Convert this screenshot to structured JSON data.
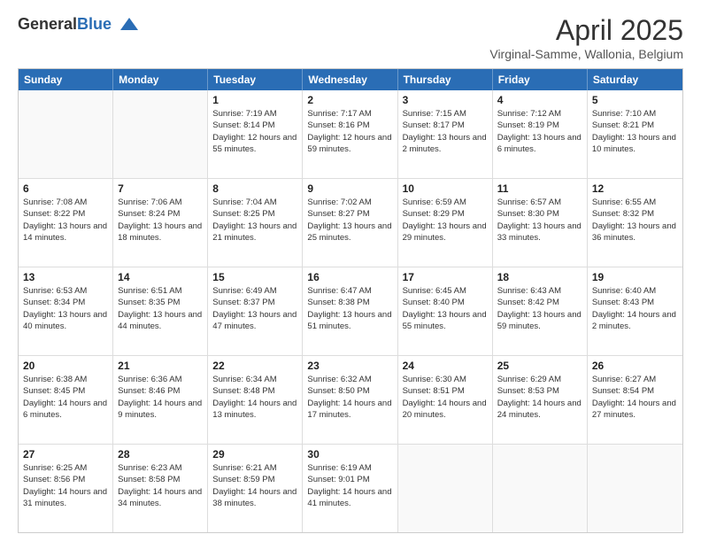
{
  "logo": {
    "general": "General",
    "blue": "Blue"
  },
  "title": "April 2025",
  "subtitle": "Virginal-Samme, Wallonia, Belgium",
  "calendar": {
    "headers": [
      "Sunday",
      "Monday",
      "Tuesday",
      "Wednesday",
      "Thursday",
      "Friday",
      "Saturday"
    ],
    "rows": [
      [
        {
          "day": "",
          "info": "",
          "empty": true
        },
        {
          "day": "",
          "info": "",
          "empty": true
        },
        {
          "day": "1",
          "info": "Sunrise: 7:19 AM\nSunset: 8:14 PM\nDaylight: 12 hours and 55 minutes.",
          "empty": false
        },
        {
          "day": "2",
          "info": "Sunrise: 7:17 AM\nSunset: 8:16 PM\nDaylight: 12 hours and 59 minutes.",
          "empty": false
        },
        {
          "day": "3",
          "info": "Sunrise: 7:15 AM\nSunset: 8:17 PM\nDaylight: 13 hours and 2 minutes.",
          "empty": false
        },
        {
          "day": "4",
          "info": "Sunrise: 7:12 AM\nSunset: 8:19 PM\nDaylight: 13 hours and 6 minutes.",
          "empty": false
        },
        {
          "day": "5",
          "info": "Sunrise: 7:10 AM\nSunset: 8:21 PM\nDaylight: 13 hours and 10 minutes.",
          "empty": false
        }
      ],
      [
        {
          "day": "6",
          "info": "Sunrise: 7:08 AM\nSunset: 8:22 PM\nDaylight: 13 hours and 14 minutes.",
          "empty": false
        },
        {
          "day": "7",
          "info": "Sunrise: 7:06 AM\nSunset: 8:24 PM\nDaylight: 13 hours and 18 minutes.",
          "empty": false
        },
        {
          "day": "8",
          "info": "Sunrise: 7:04 AM\nSunset: 8:25 PM\nDaylight: 13 hours and 21 minutes.",
          "empty": false
        },
        {
          "day": "9",
          "info": "Sunrise: 7:02 AM\nSunset: 8:27 PM\nDaylight: 13 hours and 25 minutes.",
          "empty": false
        },
        {
          "day": "10",
          "info": "Sunrise: 6:59 AM\nSunset: 8:29 PM\nDaylight: 13 hours and 29 minutes.",
          "empty": false
        },
        {
          "day": "11",
          "info": "Sunrise: 6:57 AM\nSunset: 8:30 PM\nDaylight: 13 hours and 33 minutes.",
          "empty": false
        },
        {
          "day": "12",
          "info": "Sunrise: 6:55 AM\nSunset: 8:32 PM\nDaylight: 13 hours and 36 minutes.",
          "empty": false
        }
      ],
      [
        {
          "day": "13",
          "info": "Sunrise: 6:53 AM\nSunset: 8:34 PM\nDaylight: 13 hours and 40 minutes.",
          "empty": false
        },
        {
          "day": "14",
          "info": "Sunrise: 6:51 AM\nSunset: 8:35 PM\nDaylight: 13 hours and 44 minutes.",
          "empty": false
        },
        {
          "day": "15",
          "info": "Sunrise: 6:49 AM\nSunset: 8:37 PM\nDaylight: 13 hours and 47 minutes.",
          "empty": false
        },
        {
          "day": "16",
          "info": "Sunrise: 6:47 AM\nSunset: 8:38 PM\nDaylight: 13 hours and 51 minutes.",
          "empty": false
        },
        {
          "day": "17",
          "info": "Sunrise: 6:45 AM\nSunset: 8:40 PM\nDaylight: 13 hours and 55 minutes.",
          "empty": false
        },
        {
          "day": "18",
          "info": "Sunrise: 6:43 AM\nSunset: 8:42 PM\nDaylight: 13 hours and 59 minutes.",
          "empty": false
        },
        {
          "day": "19",
          "info": "Sunrise: 6:40 AM\nSunset: 8:43 PM\nDaylight: 14 hours and 2 minutes.",
          "empty": false
        }
      ],
      [
        {
          "day": "20",
          "info": "Sunrise: 6:38 AM\nSunset: 8:45 PM\nDaylight: 14 hours and 6 minutes.",
          "empty": false
        },
        {
          "day": "21",
          "info": "Sunrise: 6:36 AM\nSunset: 8:46 PM\nDaylight: 14 hours and 9 minutes.",
          "empty": false
        },
        {
          "day": "22",
          "info": "Sunrise: 6:34 AM\nSunset: 8:48 PM\nDaylight: 14 hours and 13 minutes.",
          "empty": false
        },
        {
          "day": "23",
          "info": "Sunrise: 6:32 AM\nSunset: 8:50 PM\nDaylight: 14 hours and 17 minutes.",
          "empty": false
        },
        {
          "day": "24",
          "info": "Sunrise: 6:30 AM\nSunset: 8:51 PM\nDaylight: 14 hours and 20 minutes.",
          "empty": false
        },
        {
          "day": "25",
          "info": "Sunrise: 6:29 AM\nSunset: 8:53 PM\nDaylight: 14 hours and 24 minutes.",
          "empty": false
        },
        {
          "day": "26",
          "info": "Sunrise: 6:27 AM\nSunset: 8:54 PM\nDaylight: 14 hours and 27 minutes.",
          "empty": false
        }
      ],
      [
        {
          "day": "27",
          "info": "Sunrise: 6:25 AM\nSunset: 8:56 PM\nDaylight: 14 hours and 31 minutes.",
          "empty": false
        },
        {
          "day": "28",
          "info": "Sunrise: 6:23 AM\nSunset: 8:58 PM\nDaylight: 14 hours and 34 minutes.",
          "empty": false
        },
        {
          "day": "29",
          "info": "Sunrise: 6:21 AM\nSunset: 8:59 PM\nDaylight: 14 hours and 38 minutes.",
          "empty": false
        },
        {
          "day": "30",
          "info": "Sunrise: 6:19 AM\nSunset: 9:01 PM\nDaylight: 14 hours and 41 minutes.",
          "empty": false
        },
        {
          "day": "",
          "info": "",
          "empty": true
        },
        {
          "day": "",
          "info": "",
          "empty": true
        },
        {
          "day": "",
          "info": "",
          "empty": true
        }
      ]
    ]
  }
}
